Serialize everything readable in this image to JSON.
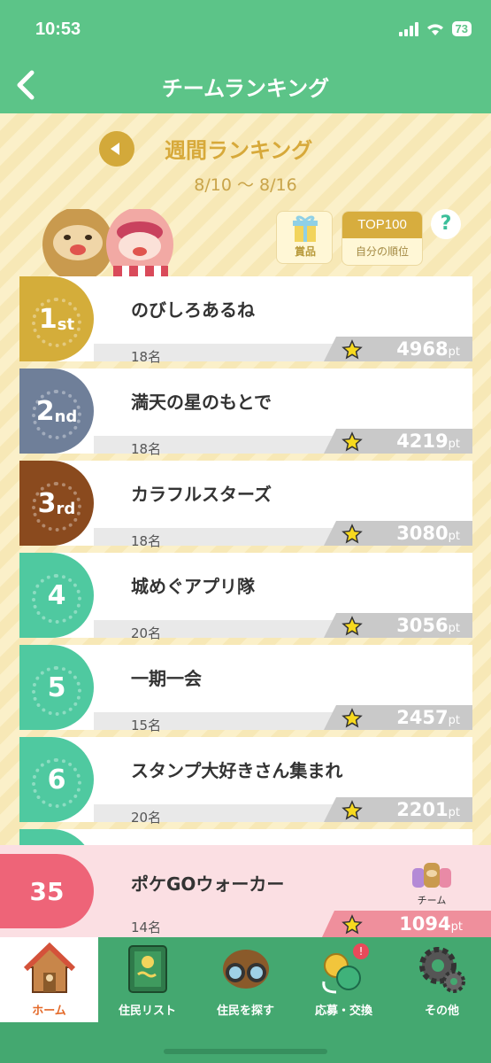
{
  "status_bar": {
    "time": "10:53",
    "battery": "73"
  },
  "header": {
    "title": "チームランキング"
  },
  "week": {
    "title": "週間ランキング",
    "range": "8/10 〜 8/16"
  },
  "buttons": {
    "prize_label": "賞品",
    "top100_label": "TOP100",
    "my_rank_label": "自分の順位",
    "help_label": "?"
  },
  "ranking": [
    {
      "rank_num": "1",
      "rank_suffix": "st",
      "name": "のびしろあるね",
      "members": "18名",
      "points": "4968",
      "unit": "pt"
    },
    {
      "rank_num": "2",
      "rank_suffix": "nd",
      "name": "満天の星のもとで",
      "members": "18名",
      "points": "4219",
      "unit": "pt"
    },
    {
      "rank_num": "3",
      "rank_suffix": "rd",
      "name": "カラフルスターズ",
      "members": "18名",
      "points": "3080",
      "unit": "pt"
    },
    {
      "rank_num": "4",
      "rank_suffix": "",
      "name": "城めぐアプリ隊",
      "members": "20名",
      "points": "3056",
      "unit": "pt"
    },
    {
      "rank_num": "5",
      "rank_suffix": "",
      "name": "一期一会",
      "members": "15名",
      "points": "2457",
      "unit": "pt"
    },
    {
      "rank_num": "6",
      "rank_suffix": "",
      "name": "スタンプ大好きさん集まれ",
      "members": "20名",
      "points": "2201",
      "unit": "pt"
    }
  ],
  "my_team": {
    "rank": "35",
    "name": "ポケGOウォーカー",
    "members": "14名",
    "points": "1094",
    "unit": "pt",
    "team_button_label": "チーム"
  },
  "nav": [
    {
      "label": "ホーム",
      "icon": "home-icon"
    },
    {
      "label": "住民リスト",
      "icon": "resident-list-icon"
    },
    {
      "label": "住民を探す",
      "icon": "binoculars-icon"
    },
    {
      "label": "応募・交換",
      "icon": "exchange-icon"
    },
    {
      "label": "その他",
      "icon": "gear-icon"
    }
  ],
  "colors": {
    "header": "#5cc488",
    "gold": "#d4ad3a",
    "silver": "#6f7f99",
    "bronze": "#8a4a1e",
    "teal": "#4fc9a0",
    "my_rank": "#ee6478",
    "nav": "#44a870"
  }
}
